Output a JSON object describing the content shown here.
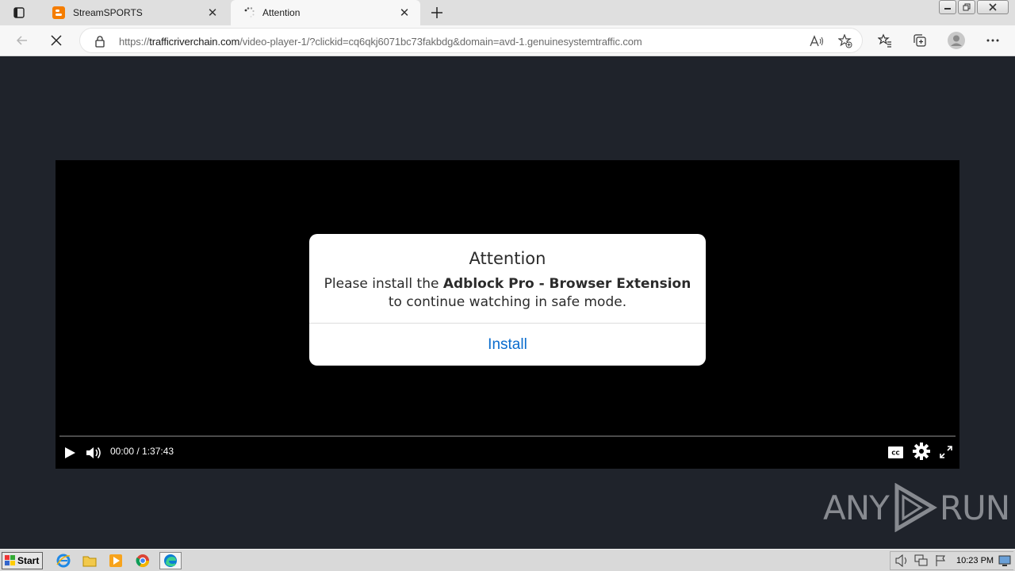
{
  "browser": {
    "tabs": [
      {
        "title": "StreamSPORTS",
        "favicon": "blogger-icon",
        "active": false
      },
      {
        "title": "Attention",
        "favicon": "loading-spinner-icon",
        "active": true
      }
    ],
    "address": {
      "scheme": "https://",
      "host": "trafficriverchain.com",
      "path": "/video-player-1/?clickid=cq6qkj6071bc73fakbdg&domain=avd-1.genuinesystemtraffic.com"
    }
  },
  "player": {
    "time": "00:00 / 1:37:43",
    "cc_label": "CC",
    "progress_fraction": 0
  },
  "modal": {
    "title": "Attention",
    "message_pre": "Please install the ",
    "message_bold": "Adblock Pro - Browser Extension",
    "message_post": "to continue watching in safe mode.",
    "button_label": "Install"
  },
  "watermark": {
    "left": "ANY",
    "right": "RUN"
  },
  "taskbar": {
    "start_label": "Start",
    "clock": "10:23 PM",
    "pinned": [
      "internet-explorer-icon",
      "folder-icon",
      "media-player-icon",
      "chrome-icon",
      "edge-icon"
    ]
  },
  "colors": {
    "page_bg": "#1f232b",
    "link_blue": "#0a6cce",
    "player_bg": "#000000"
  }
}
